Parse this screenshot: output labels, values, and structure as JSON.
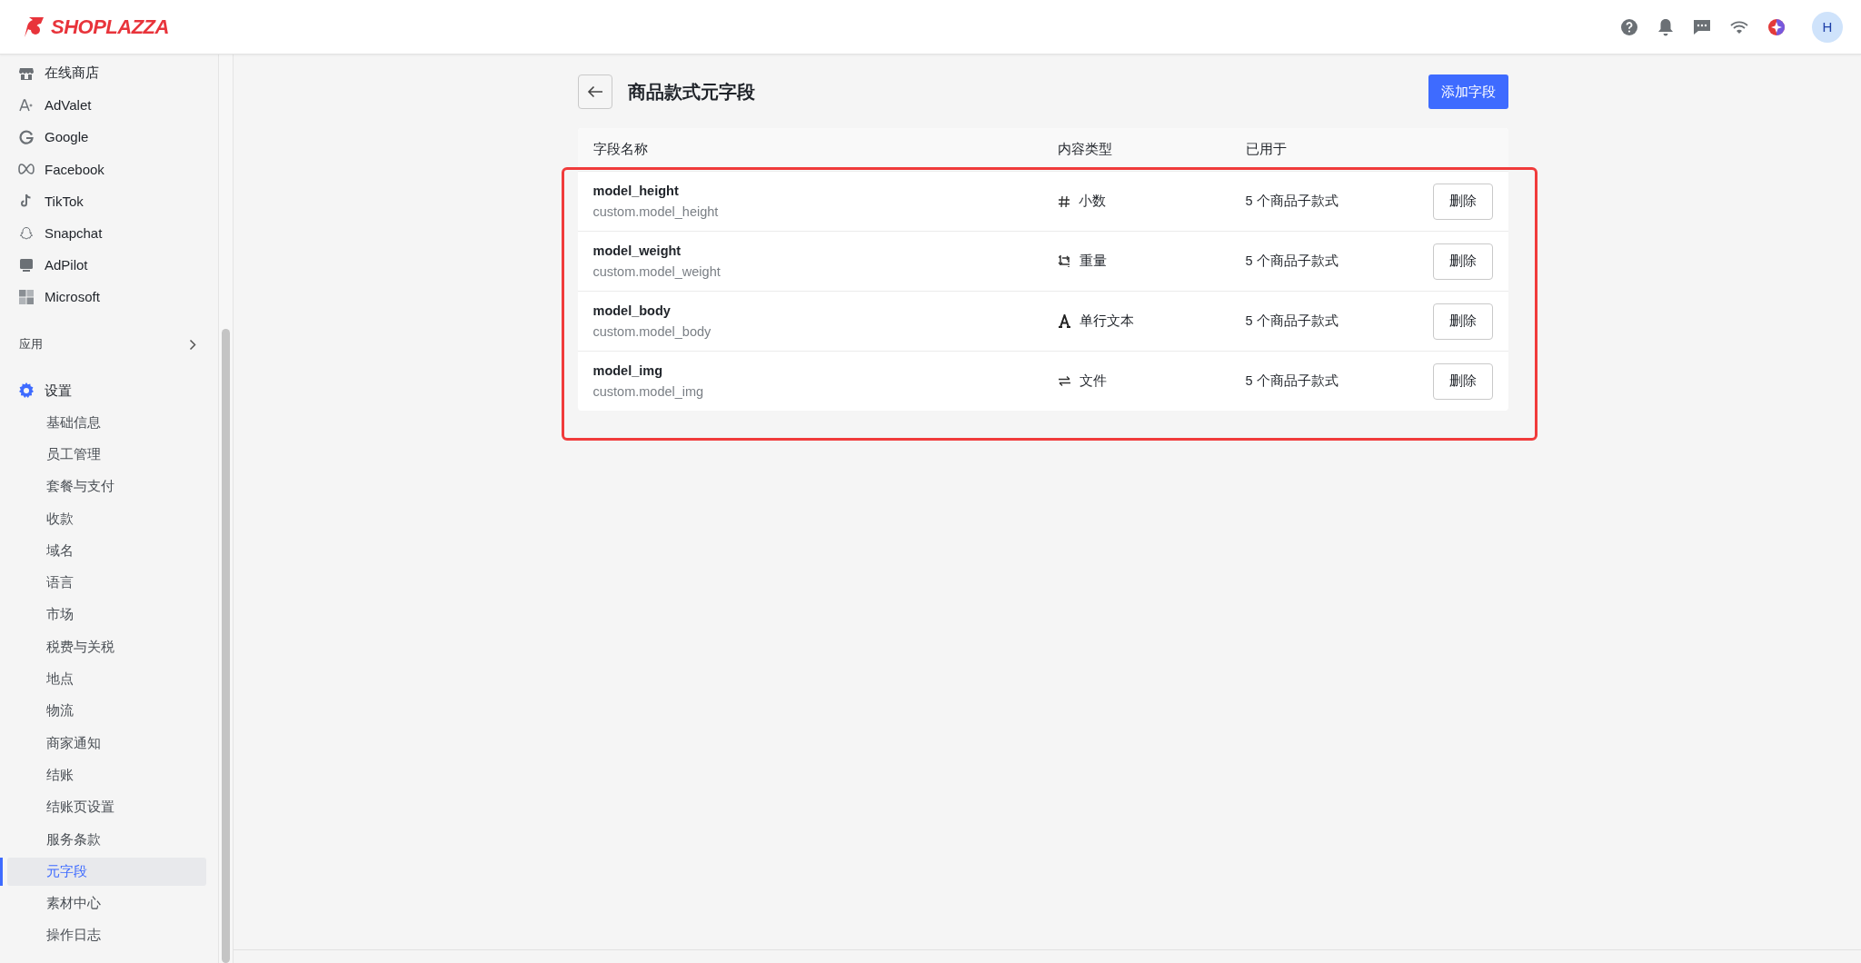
{
  "header": {
    "logo": "SHOPLAZZA",
    "avatar": "H"
  },
  "sidebar": {
    "channels": [
      {
        "label": "在线商店",
        "kind": "store"
      },
      {
        "label": "AdValet",
        "kind": "advalet"
      },
      {
        "label": "Google",
        "kind": "google"
      },
      {
        "label": "Facebook",
        "kind": "meta"
      },
      {
        "label": "TikTok",
        "kind": "tiktok"
      },
      {
        "label": "Snapchat",
        "kind": "snapchat"
      },
      {
        "label": "AdPilot",
        "kind": "adpilot"
      },
      {
        "label": "Microsoft",
        "kind": "microsoft"
      }
    ],
    "apps": {
      "label": "应用"
    },
    "settings": {
      "label": "设置",
      "items": [
        {
          "label": "基础信息",
          "selected": false
        },
        {
          "label": "员工管理",
          "selected": false
        },
        {
          "label": "套餐与支付",
          "selected": false
        },
        {
          "label": "收款",
          "selected": false
        },
        {
          "label": "域名",
          "selected": false
        },
        {
          "label": "语言",
          "selected": false
        },
        {
          "label": "市场",
          "selected": false
        },
        {
          "label": "税费与关税",
          "selected": false
        },
        {
          "label": "地点",
          "selected": false
        },
        {
          "label": "物流",
          "selected": false
        },
        {
          "label": "商家通知",
          "selected": false
        },
        {
          "label": "结账",
          "selected": false
        },
        {
          "label": "结账页设置",
          "selected": false
        },
        {
          "label": "服务条款",
          "selected": false
        },
        {
          "label": "元字段",
          "selected": true
        },
        {
          "label": "素材中心",
          "selected": false
        },
        {
          "label": "操作日志",
          "selected": false
        }
      ]
    }
  },
  "page": {
    "title": "商品款式元字段",
    "add_button": "添加字段"
  },
  "table": {
    "columns": [
      "字段名称",
      "内容类型",
      "已用于"
    ],
    "rows": [
      {
        "name": "model_height",
        "key": "custom.model_height",
        "kind": "decimal",
        "type": "小数",
        "used_in": "5 个商品子款式",
        "action": "删除"
      },
      {
        "name": "model_weight",
        "key": "custom.model_weight",
        "kind": "weight",
        "type": "重量",
        "used_in": "5 个商品子款式",
        "action": "删除"
      },
      {
        "name": "model_body",
        "key": "custom.model_body",
        "kind": "text",
        "type": "单行文本",
        "used_in": "5 个商品子款式",
        "action": "删除"
      },
      {
        "name": "model_img",
        "key": "custom.model_img",
        "kind": "file",
        "type": "文件",
        "used_in": "5 个商品子款式",
        "action": "删除"
      }
    ]
  }
}
